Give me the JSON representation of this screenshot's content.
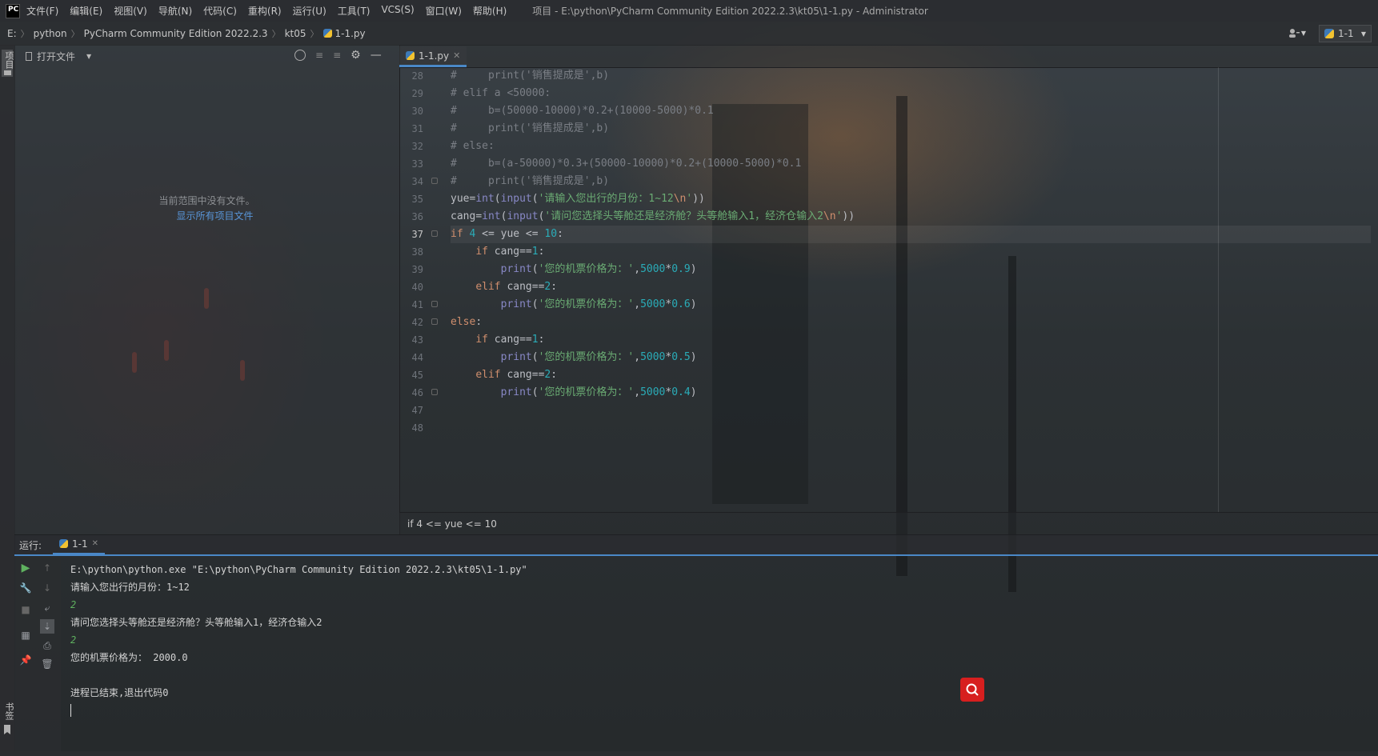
{
  "app": {
    "logo_text": "PC",
    "window_title": "项目 - E:\\python\\PyCharm Community Edition 2022.2.3\\kt05\\1-1.py - Administrator"
  },
  "menu": [
    "文件(F)",
    "编辑(E)",
    "视图(V)",
    "导航(N)",
    "代码(C)",
    "重构(R)",
    "运行(U)",
    "工具(T)",
    "VCS(S)",
    "窗口(W)",
    "帮助(H)"
  ],
  "breadcrumb": [
    "E:",
    "python",
    "PyCharm Community Edition 2022.2.3",
    "kt05",
    "1-1.py"
  ],
  "toolbar": {
    "run_config": "1-1"
  },
  "left_strip": {
    "project_label": "项目",
    "bookmarks_label": "书签"
  },
  "project_panel": {
    "open_files_label": "打开文件",
    "empty_message": "当前范围中没有文件。",
    "show_all_link": "显示所有项目文件"
  },
  "editor": {
    "tab_label": "1-1.py",
    "status_breadcrumb": "if 4 <= yue <= 10",
    "line_numbers": [
      "28",
      "29",
      "30",
      "31",
      "32",
      "33",
      "34",
      "35",
      "36",
      "37",
      "38",
      "39",
      "40",
      "41",
      "42",
      "43",
      "44",
      "45",
      "46",
      "47",
      "48"
    ],
    "active_line": "37",
    "code_lines": [
      "#     print('销售提成是',b)",
      "# elif a <50000:",
      "#     b=(50000-10000)*0.2+(10000-5000)*0.1",
      "#     print('销售提成是',b)",
      "# else:",
      "#     b=(a-50000)*0.3+(50000-10000)*0.2+(10000-5000)*0.1",
      "#     print('销售提成是',b)",
      "yue=int(input('请输入您出行的月份：1~12\\n'))",
      "cang=int(input('请问您选择头等舱还是经济舱？头等舱输入1，经济仓输入2\\n'))",
      "if 4 <= yue <= 10:",
      "    if cang==1:",
      "        print('您的机票价格为：',5000*0.9)",
      "    elif cang==2:",
      "        print('您的机票价格为：',5000*0.6)",
      "else:",
      "    if cang==1:",
      "        print('您的机票价格为：',5000*0.5)",
      "    elif cang==2:",
      "        print('您的机票价格为：',5000*0.4)",
      "",
      ""
    ]
  },
  "run": {
    "label": "运行:",
    "tab_label": "1-1",
    "console_lines": [
      "E:\\python\\python.exe \"E:\\python\\PyCharm Community Edition 2022.2.3\\kt05\\1-1.py\"",
      "请输入您出行的月份：1~12",
      "2",
      "请问您选择头等舱还是经济舱？头等舱输入1，经济仓输入2",
      "2",
      "您的机票价格为： 2000.0",
      "",
      "进程已结束,退出代码0"
    ]
  },
  "colors": {
    "accent": "#4a88c7",
    "search_button": "#d71f1f"
  }
}
